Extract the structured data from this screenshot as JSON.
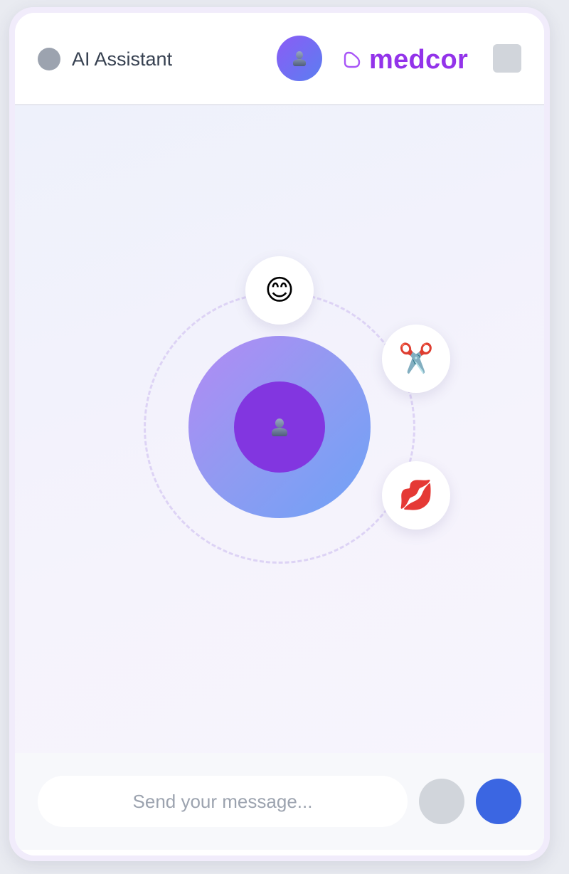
{
  "header": {
    "title": "AI Assistant",
    "avatar_icon": "user-icon",
    "logo_text": "medcor",
    "status_color": "#9ca3af",
    "brand_color": "#9333ea"
  },
  "center": {
    "avatar_icon": "user-icon",
    "accent_color": "#8236e0"
  },
  "features": [
    {
      "icon": "smile-emoji",
      "glyph": "😊"
    },
    {
      "icon": "scissors-emoji",
      "glyph": "✂️"
    },
    {
      "icon": "lips-emoji",
      "glyph": "💋"
    }
  ],
  "composer": {
    "placeholder": "Send your message...",
    "mic_icon": "microphone-icon",
    "send_icon": "send-icon",
    "send_color": "#3b66e2"
  }
}
